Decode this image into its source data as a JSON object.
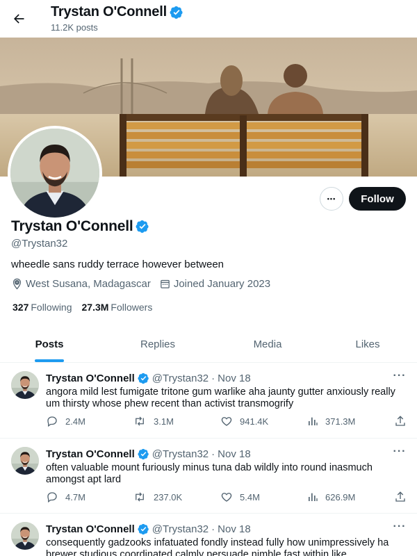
{
  "header": {
    "name": "Trystan O'Connell",
    "post_count": "11.2K posts"
  },
  "profile": {
    "name": "Trystan O'Connell",
    "handle": "@Trystan32",
    "bio": "wheedle sans ruddy terrace however between",
    "location": "West Susana, Madagascar",
    "joined": "Joined January 2023",
    "following_count": "327",
    "following_label": "Following",
    "followers_count": "27.3M",
    "followers_label": "Followers",
    "follow_label": "Follow",
    "more_label": "•••"
  },
  "tabs": [
    {
      "label": "Posts",
      "active": true
    },
    {
      "label": "Replies",
      "active": false
    },
    {
      "label": "Media",
      "active": false
    },
    {
      "label": "Likes",
      "active": false
    }
  ],
  "posts": [
    {
      "name": "Trystan O'Connell",
      "handle": "@Trystan32",
      "sep": "·",
      "date": "Nov 18",
      "text": "angora mild lest fumigate tritone gum warlike aha jaunty gutter anxiously really um thirsty whose phew recent than activist transmogrify",
      "replies": "2.4M",
      "reposts": "3.1M",
      "likes": "941.4K",
      "views": "371.3M"
    },
    {
      "name": "Trystan O'Connell",
      "handle": "@Trystan32",
      "sep": "·",
      "date": "Nov 18",
      "text": "often valuable mount furiously minus tuna dab wildly into round inasmuch amongst apt lard",
      "replies": "4.7M",
      "reposts": "237.0K",
      "likes": "5.4M",
      "views": "626.9M"
    },
    {
      "name": "Trystan O'Connell",
      "handle": "@Trystan32",
      "sep": "·",
      "date": "Nov 18",
      "text": "consequently gadzooks infatuated fondly instead fully how unimpressively ha brewer studious coordinated calmly persuade nimble fast within like"
    }
  ],
  "colors": {
    "accent": "#1d9bf0",
    "text": "#0f1419",
    "muted": "#536471",
    "border": "#eff3f4"
  },
  "icons": [
    "back-arrow-icon",
    "verified-badge-icon",
    "location-icon",
    "calendar-icon",
    "reply-icon",
    "repost-icon",
    "like-icon",
    "views-icon",
    "share-icon"
  ]
}
